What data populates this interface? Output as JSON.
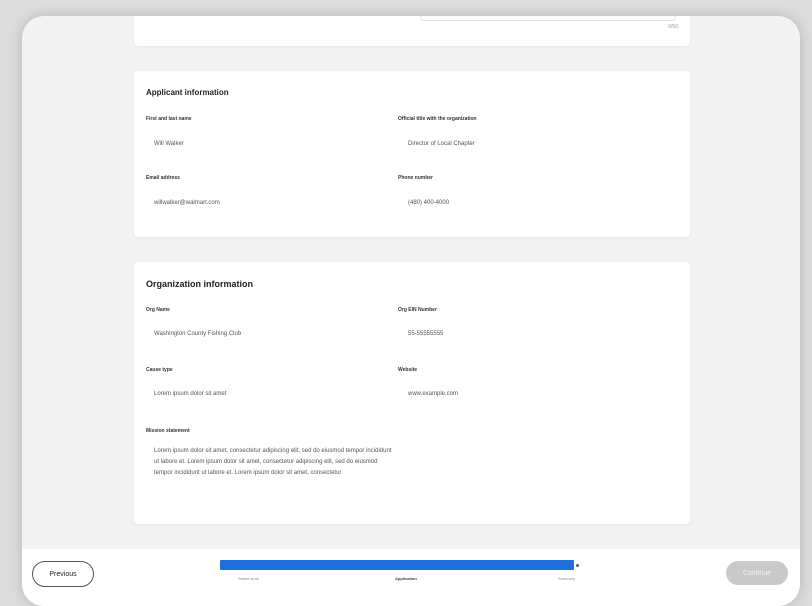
{
  "top_card": {
    "char_count": "0/50"
  },
  "applicant": {
    "title": "Applicant information",
    "name_label": "First and last name",
    "name_value": "Will Walker",
    "title_label": "Official title with the organization",
    "title_value": "Director of Local Chapter",
    "email_label": "Email address",
    "email_value": "willwalker@walmart.com",
    "phone_label": "Phone number",
    "phone_value": "(480) 400-4000"
  },
  "organization": {
    "title": "Organization information",
    "org_name_label": "Org Name",
    "org_name_value": "Washington County Fishing Club",
    "ein_label": "Org EIN Number",
    "ein_value": "55-55555555",
    "cause_label": "Cause type",
    "cause_value": "Lorem ipsum dolor sit amet",
    "website_label": "Website",
    "website_value": "www.example.com",
    "mission_label": "Mission statement",
    "mission_value": "Lorem ipsum dolor sit amet, consectetur adipiscing elit, sed do eiusmod tempor incididunt ut labore et. Lorem ipsum dolor sit amet, consectetur adipiscing elit, sed do eiusmod tempor incididunt ut labore et. Lorem ipsum dolor sit amet, consectetur"
  },
  "footer": {
    "previous_label": "Previous",
    "continue_label": "Continue",
    "steps": [
      "Select store",
      "Application",
      "Summary"
    ],
    "active_step": 1,
    "accent_color": "#1e6fd9"
  }
}
